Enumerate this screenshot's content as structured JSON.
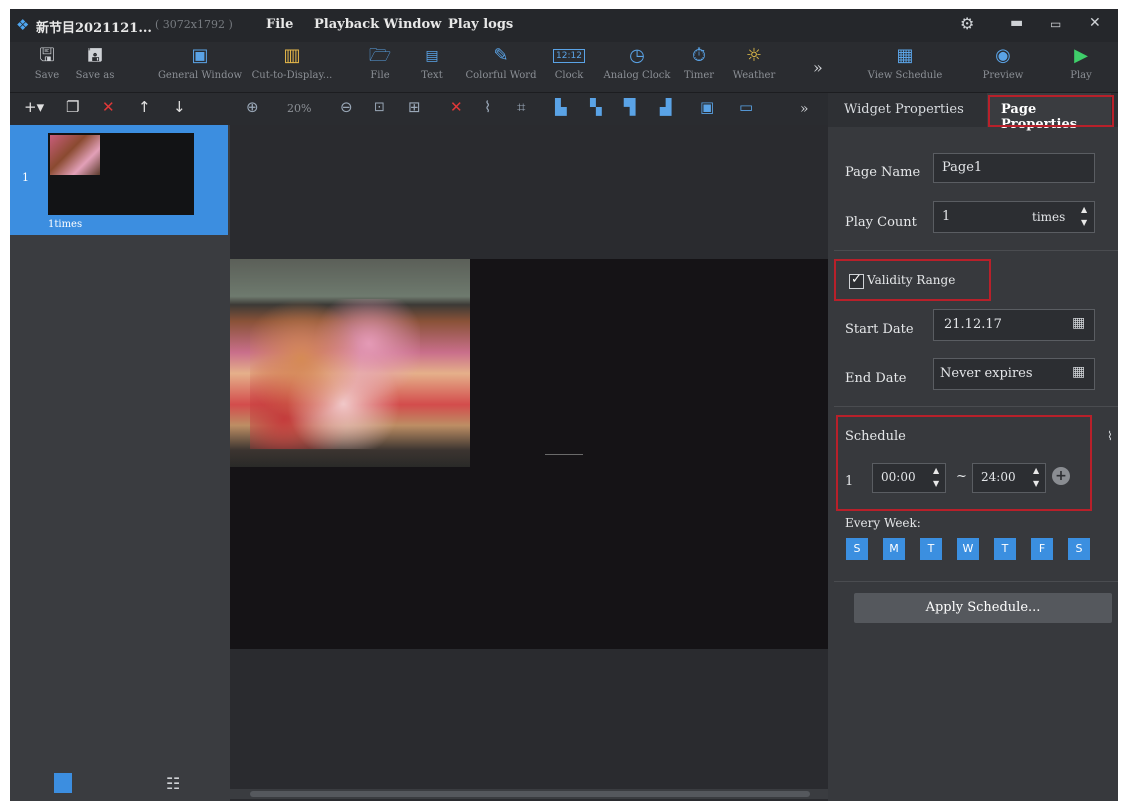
{
  "titlebar": {
    "app_title": "新节目2021121...",
    "resolution": "( 3072x1792 )",
    "menu": [
      "File",
      "Playback Window",
      "Play logs"
    ]
  },
  "toolbar": {
    "items": [
      {
        "label": "Save",
        "icon": "save-icon"
      },
      {
        "label": "Save as",
        "icon": "save-as-icon"
      },
      {
        "label": "General Window",
        "icon": "window-icon"
      },
      {
        "label": "Cut-to-Display...",
        "icon": "cut-icon"
      },
      {
        "label": "File",
        "icon": "folder-icon"
      },
      {
        "label": "Text",
        "icon": "text-icon"
      },
      {
        "label": "Colorful Word",
        "icon": "colorful-word-icon"
      },
      {
        "label": "Clock",
        "icon": "digital-clock-icon",
        "glyph_text": "12:12"
      },
      {
        "label": "Analog Clock",
        "icon": "analog-clock-icon"
      },
      {
        "label": "Timer",
        "icon": "timer-icon"
      },
      {
        "label": "Weather",
        "icon": "weather-icon"
      }
    ],
    "more": "»",
    "right_items": [
      {
        "label": "View Schedule",
        "icon": "calendar-icon"
      },
      {
        "label": "Preview",
        "icon": "eye-icon"
      },
      {
        "label": "Play",
        "icon": "play-icon"
      }
    ]
  },
  "subtoolbar": {
    "zoom": "20%",
    "more": "»"
  },
  "page_list": {
    "items": [
      {
        "index": "1",
        "caption": "1times"
      }
    ]
  },
  "right_panel": {
    "tabs": [
      {
        "label": "Widget Properties",
        "active": false
      },
      {
        "label": "Page Properties",
        "active": true
      }
    ],
    "page_name_label": "Page Name",
    "page_name_value": "Page1",
    "play_count_label": "Play Count",
    "play_count_value": "1",
    "play_count_unit": "times",
    "validity_label": "Validity Range",
    "validity_checked": true,
    "start_date_label": "Start Date",
    "start_date_value": "21.12.17",
    "end_date_label": "End Date",
    "end_date_value": "Never expires",
    "schedule_label": "Schedule",
    "schedule_rows": [
      {
        "index": "1",
        "start": "00:00",
        "separator": "~",
        "end": "24:00"
      }
    ],
    "every_week_label": "Every Week:",
    "days": [
      "S",
      "M",
      "T",
      "W",
      "T",
      "F",
      "S"
    ],
    "apply_label": "Apply Schedule..."
  },
  "colors": {
    "accent": "#3b8fe0",
    "highlight_box": "#b8202a",
    "background": "#2f3135"
  }
}
